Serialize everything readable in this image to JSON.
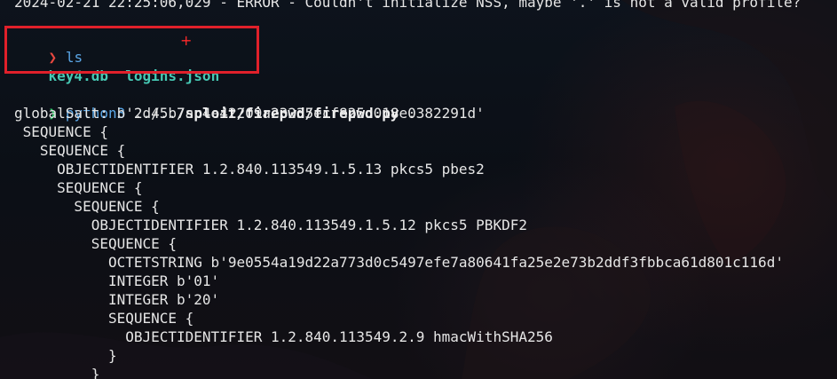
{
  "terminal": {
    "top_line": "2024-02-21 22:25:06,029 - ERROR - Couldn't initialize NSS, maybe '.' is not a valid profile?",
    "prompt_symbol": "❯",
    "cmd1": "ls",
    "ls_file1": "key4.db",
    "ls_file2": "logins.json",
    "cmd2_prog": "python3",
    "cmd2_path_prefix": "../../",
    "cmd2_path_bold": "sploit/firepwd/firepwd.py",
    "cmd2_arg": " .",
    "cursor_marker": "+",
    "output": [
      "globalSalt: b'2d45b7ac4e42209a23235ecf825c018e0382291d'",
      " SEQUENCE {",
      "   SEQUENCE {",
      "     OBJECTIDENTIFIER 1.2.840.113549.1.5.13 pkcs5 pbes2",
      "     SEQUENCE {",
      "       SEQUENCE {",
      "         OBJECTIDENTIFIER 1.2.840.113549.1.5.12 pkcs5 PBKDF2",
      "         SEQUENCE {",
      "           OCTETSTRING b'9e0554a19d22a773d0c5497efe7a80641fa25e2e73b2ddf3fbbca61d801c116d'",
      "           INTEGER b'01'",
      "           INTEGER b'20'",
      "           SEQUENCE {",
      "             OBJECTIDENTIFIER 1.2.840.113549.2.9 hmacWithSHA256",
      "           }",
      "         }"
    ]
  },
  "colors": {
    "highlight_box": "#e0202a",
    "prompt_ls": "#e8483f",
    "prompt_python": "#35c46a",
    "command": "#5aa6e6",
    "filenames": "#46c9b4"
  }
}
